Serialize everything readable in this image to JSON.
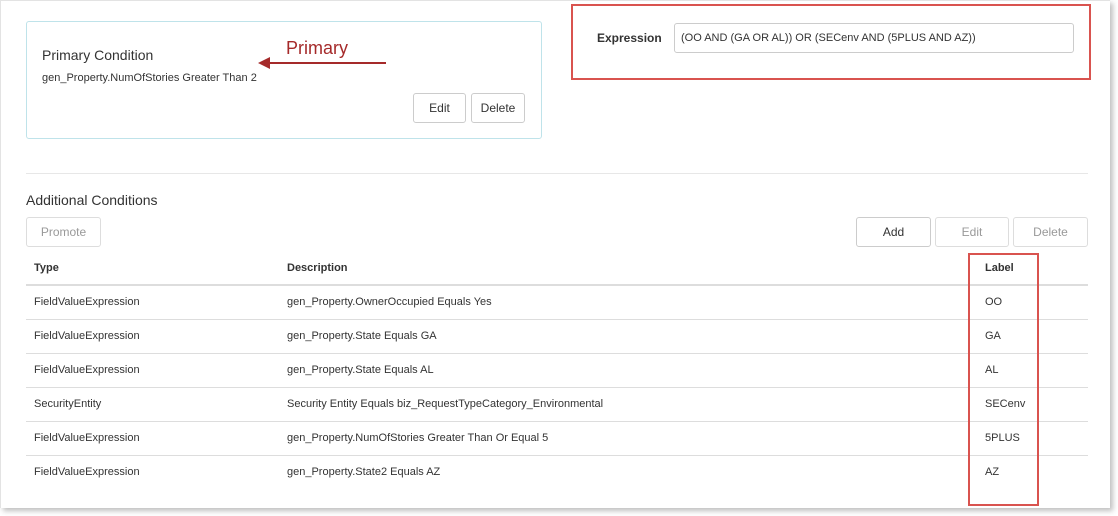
{
  "primary": {
    "title": "Primary Condition",
    "description": "gen_Property.NumOfStories Greater Than 2",
    "annotation": "Primary",
    "edit_label": "Edit",
    "delete_label": "Delete"
  },
  "expression": {
    "label": "Expression",
    "value": "(OO AND (GA OR AL)) OR (SECenv AND (5PLUS AND AZ))"
  },
  "additional": {
    "title": "Additional Conditions",
    "promote_label": "Promote",
    "add_label": "Add",
    "edit_label": "Edit",
    "delete_label": "Delete",
    "columns": [
      "Type",
      "Description",
      "Label"
    ],
    "rows": [
      {
        "type": "FieldValueExpression",
        "description": "gen_Property.OwnerOccupied Equals Yes",
        "label": "OO"
      },
      {
        "type": "FieldValueExpression",
        "description": "gen_Property.State Equals GA",
        "label": "GA"
      },
      {
        "type": "FieldValueExpression",
        "description": "gen_Property.State Equals AL",
        "label": "AL"
      },
      {
        "type": "SecurityEntity",
        "description": "Security Entity Equals biz_RequestTypeCategory_Environmental",
        "label": "SECenv"
      },
      {
        "type": "FieldValueExpression",
        "description": "gen_Property.NumOfStories Greater Than Or Equal 5",
        "label": "5PLUS"
      },
      {
        "type": "FieldValueExpression",
        "description": "gen_Property.State2 Equals AZ",
        "label": "AZ"
      }
    ]
  },
  "colors": {
    "annotation": "#a52a2a",
    "highlight": "#d9534f",
    "card_border": "#bfe3ea"
  }
}
